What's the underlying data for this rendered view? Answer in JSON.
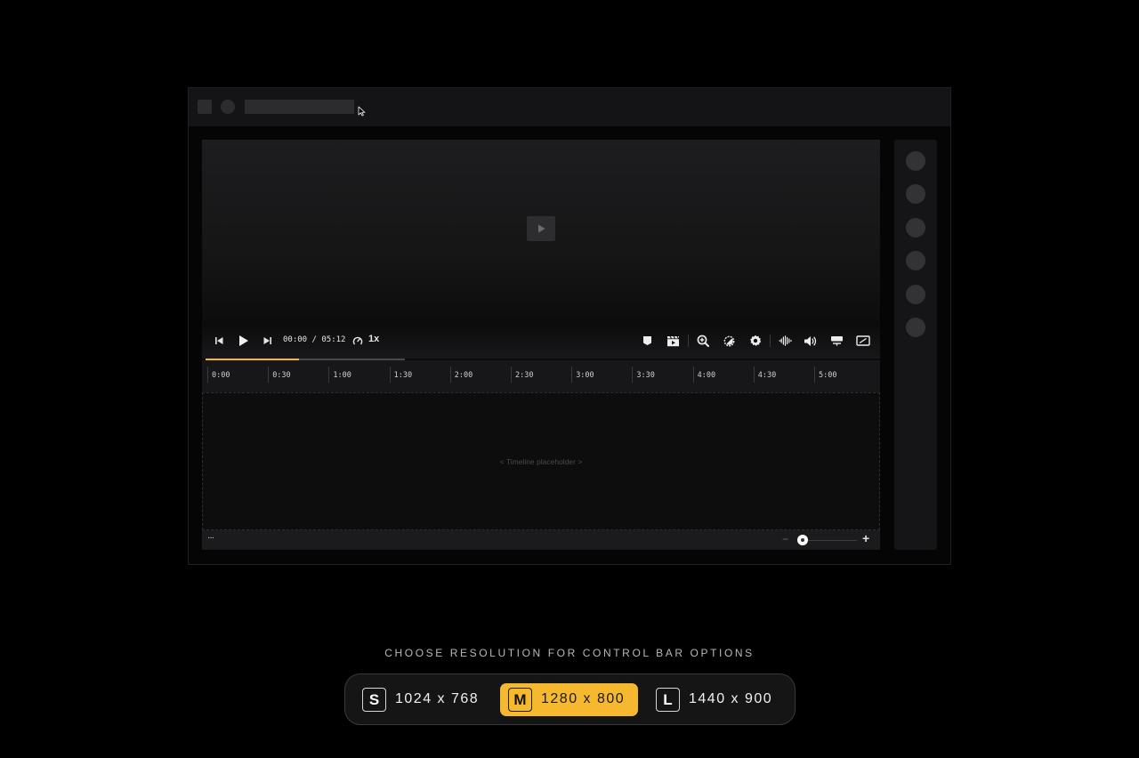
{
  "player": {
    "time_current": "00:00",
    "time_separator": "/",
    "time_total": "05:12",
    "speed": "1x",
    "progress_fraction": 0.29,
    "progress_played_fraction": 0.47,
    "timeline_placeholder": "< Timeline placeholder >",
    "more_label": "···",
    "zoom_minus": "−",
    "zoom_plus": "+",
    "zoom_level_fraction": 0.0
  },
  "ruler": {
    "ticks": [
      "0:00",
      "0:30",
      "1:00",
      "1:30",
      "2:00",
      "2:30",
      "3:00",
      "3:30",
      "4:00",
      "4:30",
      "5:00"
    ]
  },
  "icons": {
    "toolbar_left": [
      "skip-back-icon",
      "play-icon",
      "skip-forward-icon",
      "speed-gauge-icon"
    ],
    "toolbar_right": [
      "bookmark-icon",
      "clapperboard-icon",
      "zoom-in-icon",
      "color-adjust-icon",
      "settings-gear-icon",
      "waveform-icon",
      "volume-icon",
      "subtitles-icon",
      "aspect-ratio-icon"
    ]
  },
  "resolution": {
    "label": "CHOOSE RESOLUTION FOR CONTROL BAR OPTIONS",
    "options": [
      {
        "key": "S",
        "value": "1024 x 768",
        "active": false
      },
      {
        "key": "M",
        "value": "1280 x 800",
        "active": true
      },
      {
        "key": "L",
        "value": "1440 x 900",
        "active": false
      }
    ]
  },
  "colors": {
    "accent": "#f5b82e",
    "background": "#000000",
    "panel": "#151517"
  }
}
